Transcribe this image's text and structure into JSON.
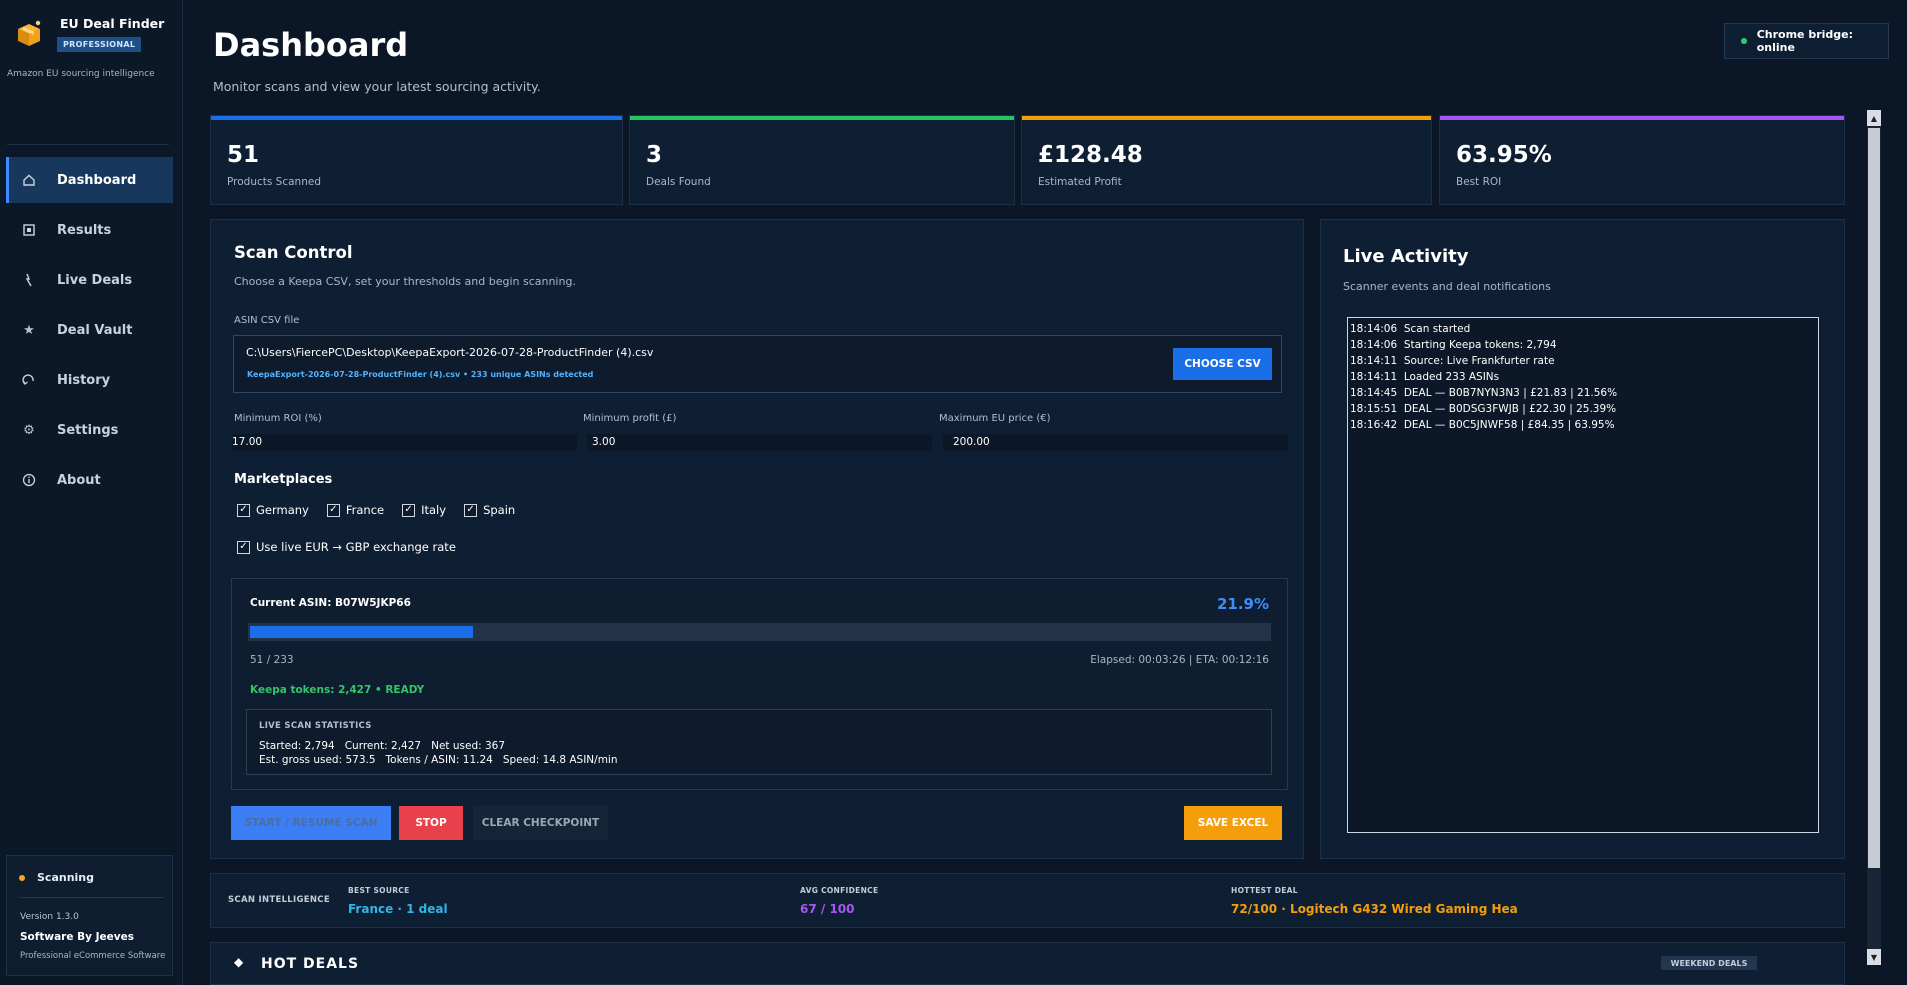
{
  "app": {
    "title": "EU Deal Finder",
    "badge": "PROFESSIONAL",
    "subtitle": "Amazon EU sourcing intelligence"
  },
  "nav": [
    {
      "label": "Dashboard",
      "icon": "home-icon",
      "active": true
    },
    {
      "label": "Results",
      "icon": "results-icon",
      "active": false
    },
    {
      "label": "Live Deals",
      "icon": "lightning-icon",
      "active": false
    },
    {
      "label": "Deal Vault",
      "icon": "star-icon",
      "active": false
    },
    {
      "label": "History",
      "icon": "history-icon",
      "active": false
    },
    {
      "label": "Settings",
      "icon": "gear-icon",
      "active": false
    },
    {
      "label": "About",
      "icon": "info-icon",
      "active": false
    }
  ],
  "sidebar_status": {
    "state": "Scanning",
    "version": "Version 1.3.0",
    "by": "Software By Jeeves",
    "tagline": "Professional eCommerce Software",
    "dot_color": "#f5a524"
  },
  "header": {
    "title": "Dashboard",
    "subtitle": "Monitor scans and view your latest sourcing activity.",
    "bridge": "Chrome bridge: online"
  },
  "stats": [
    {
      "value": "51",
      "label": "Products Scanned",
      "color": "#1a6fe8"
    },
    {
      "value": "3",
      "label": "Deals Found",
      "color": "#22c55e"
    },
    {
      "value": "£128.48",
      "label": "Estimated Profit",
      "color": "#f59e0b"
    },
    {
      "value": "63.95%",
      "label": "Best ROI",
      "color": "#a855f7"
    }
  ],
  "scan": {
    "title": "Scan Control",
    "subtitle": "Choose a Keepa CSV, set your thresholds and begin scanning.",
    "file_label": "ASIN CSV file",
    "file_path": "C:\\Users\\FiercePC\\Desktop\\KeepaExport-2026-07-28-ProductFinder (4).csv",
    "file_meta": "KeepaExport-2026-07-28-ProductFinder (4).csv  •  233 unique ASINs detected",
    "choose_csv": "CHOOSE CSV",
    "min_roi_label": "Minimum ROI (%)",
    "min_roi": "17.00",
    "min_profit_label": "Minimum profit (£)",
    "min_profit": "3.00",
    "max_price_label": "Maximum EU price (€)",
    "max_price": "200.00",
    "marketplaces_title": "Marketplaces",
    "marketplaces": [
      {
        "label": "Germany",
        "checked": true
      },
      {
        "label": "France",
        "checked": true
      },
      {
        "label": "Italy",
        "checked": true
      },
      {
        "label": "Spain",
        "checked": true
      }
    ],
    "live_fx_label": "Use live EUR → GBP exchange rate",
    "live_fx_checked": true,
    "current_asin": "Current ASIN: B07W5JKP66",
    "progress_pct_label": "21.9%",
    "progress_fraction": 0.219,
    "count": "51 / 233",
    "elapsed": "Elapsed: 00:03:26 | ETA: 00:12:16",
    "tokens": "Keepa tokens: 2,427 • READY",
    "stats_title": "LIVE SCAN STATISTICS",
    "stats_line1": "Started: 2,794   Current: 2,427   Net used: 367",
    "stats_line2": "Est. gross used: 573.5   Tokens / ASIN: 11.24   Speed: 14.8 ASIN/min",
    "btn_start": "START / RESUME SCAN",
    "btn_stop": "STOP",
    "btn_clear": "CLEAR CHECKPOINT",
    "btn_save": "SAVE EXCEL"
  },
  "live": {
    "title": "Live Activity",
    "subtitle": "Scanner events and deal notifications",
    "log": [
      "18:14:06  Scan started",
      "18:14:06  Starting Keepa tokens: 2,794",
      "18:14:11  Source: Live Frankfurter rate",
      "18:14:11  Loaded 233 ASINs",
      "18:14:45  DEAL — B0B7NYN3N3 | £21.83 | 21.56%",
      "18:15:51  DEAL — B0DSG3FWJB | £22.30 | 25.39%",
      "18:16:42  DEAL — B0C5JNWF58 | £84.35 | 63.95%"
    ]
  },
  "intel": {
    "title": "SCAN INTELLIGENCE",
    "best_source_label": "BEST SOURCE",
    "best_source": "France · 1 deal",
    "avg_conf_label": "AVG CONFIDENCE",
    "avg_conf": "67 / 100",
    "hottest_label": "HOTTEST DEAL",
    "hottest": "72/100 · Logitech G432 Wired Gaming Hea"
  },
  "hot_deals": {
    "title": "HOT DEALS",
    "badge": "WEEKEND DEALS"
  }
}
